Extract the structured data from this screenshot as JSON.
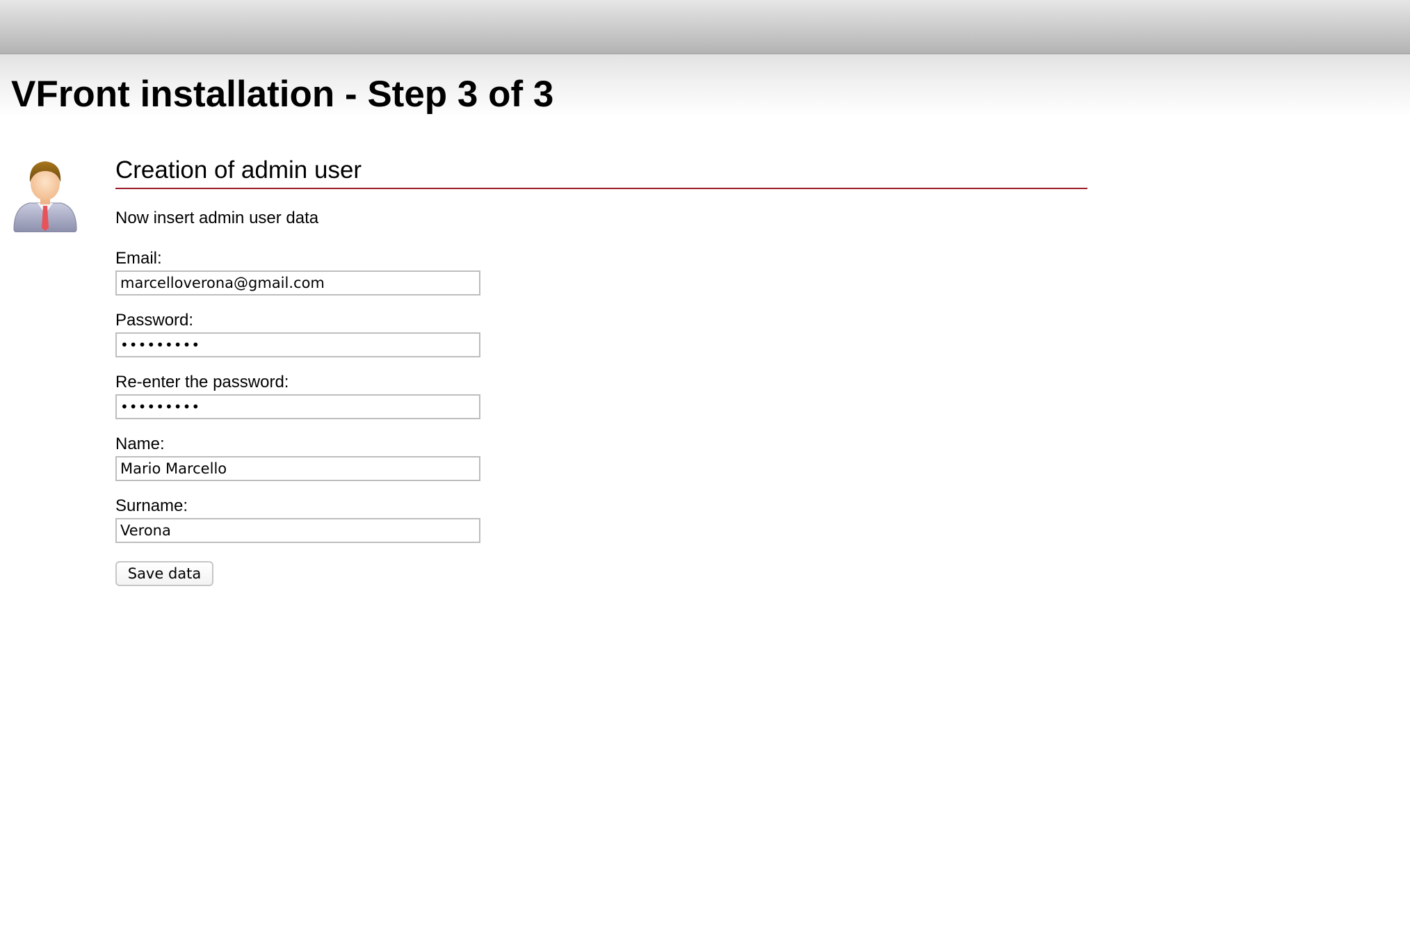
{
  "header": {
    "title": "VFront installation - Step 3 of 3"
  },
  "section": {
    "title": "Creation of admin user",
    "intro": "Now insert admin user data",
    "avatar_icon": "admin-user-icon"
  },
  "form": {
    "email": {
      "label": "Email:",
      "value": "marcelloverona@gmail.com"
    },
    "password": {
      "label": "Password:",
      "value": "secret123"
    },
    "password_confirm": {
      "label": "Re-enter the password:",
      "value": "secret123"
    },
    "name": {
      "label": "Name:",
      "value": "Mario Marcello"
    },
    "surname": {
      "label": "Surname:",
      "value": "Verona"
    },
    "save_label": "Save data"
  },
  "colors": {
    "section_rule": "#9b1a26",
    "input_border": "#bdbdbd"
  }
}
